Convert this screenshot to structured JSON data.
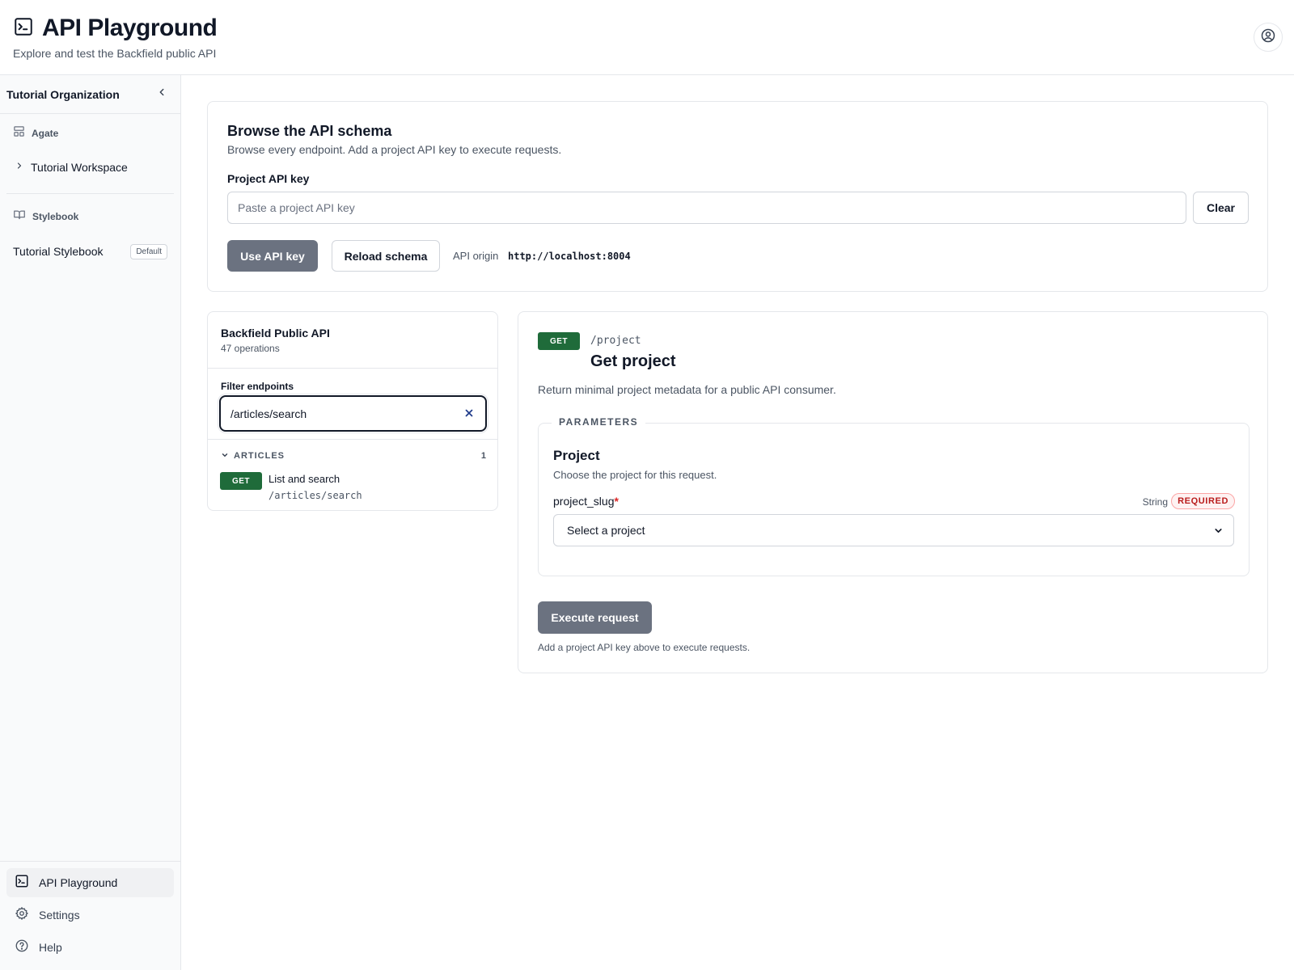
{
  "header": {
    "title": "API Playground",
    "subtitle": "Explore and test the Backfield public API",
    "icon": "terminal-icon",
    "user_icon": "user-circle-icon"
  },
  "sidebar": {
    "org_name": "Tutorial Organization",
    "collapse_icon": "chevron-left-icon",
    "agate_section": {
      "label": "Agate",
      "icon": "layout-icon"
    },
    "workspace": {
      "label": "Tutorial Workspace",
      "icon": "chevron-right-icon"
    },
    "stylebook_section": {
      "label": "Stylebook",
      "icon": "book-icon"
    },
    "stylebook_item": {
      "label": "Tutorial Stylebook",
      "badge": "Default"
    },
    "bottom_nav": [
      {
        "label": "API Playground",
        "icon": "terminal-icon",
        "active": true
      },
      {
        "label": "Settings",
        "icon": "gear-icon",
        "active": false
      },
      {
        "label": "Help",
        "icon": "help-circle-icon",
        "active": false
      }
    ]
  },
  "schema_card": {
    "title": "Browse the API schema",
    "description": "Browse every endpoint. Add a project API key to execute requests.",
    "key_label": "Project API key",
    "key_placeholder": "Paste a project API key",
    "key_value": "",
    "clear_label": "Clear",
    "use_key_label": "Use API key",
    "reload_label": "Reload schema",
    "origin_label": "API origin",
    "origin_value": "http://localhost:8004"
  },
  "endpoint_list": {
    "api_name": "Backfield Public API",
    "operation_count": "47 operations",
    "filter_label": "Filter endpoints",
    "filter_value": "/articles/search",
    "groups": [
      {
        "name": "ARTICLES",
        "count": "1",
        "endpoints": [
          {
            "method": "GET",
            "summary": "List and search",
            "path": "/articles/search"
          }
        ]
      }
    ]
  },
  "detail": {
    "method": "GET",
    "path": "/project",
    "title": "Get project",
    "description": "Return minimal project metadata for a public API consumer.",
    "parameters_legend": "PARAMETERS",
    "param_group_title": "Project",
    "param_group_help": "Choose the project for this request.",
    "param_name": "project_slug",
    "param_required_marker": "*",
    "param_type": "String",
    "param_required_badge": "REQUIRED",
    "select_value": "Select a project",
    "execute_label": "Execute request",
    "execute_hint": "Add a project API key above to execute requests."
  },
  "colors": {
    "get_badge": "#1f6b3a",
    "disabled_button": "#6b7280",
    "required": "#dc2626"
  }
}
